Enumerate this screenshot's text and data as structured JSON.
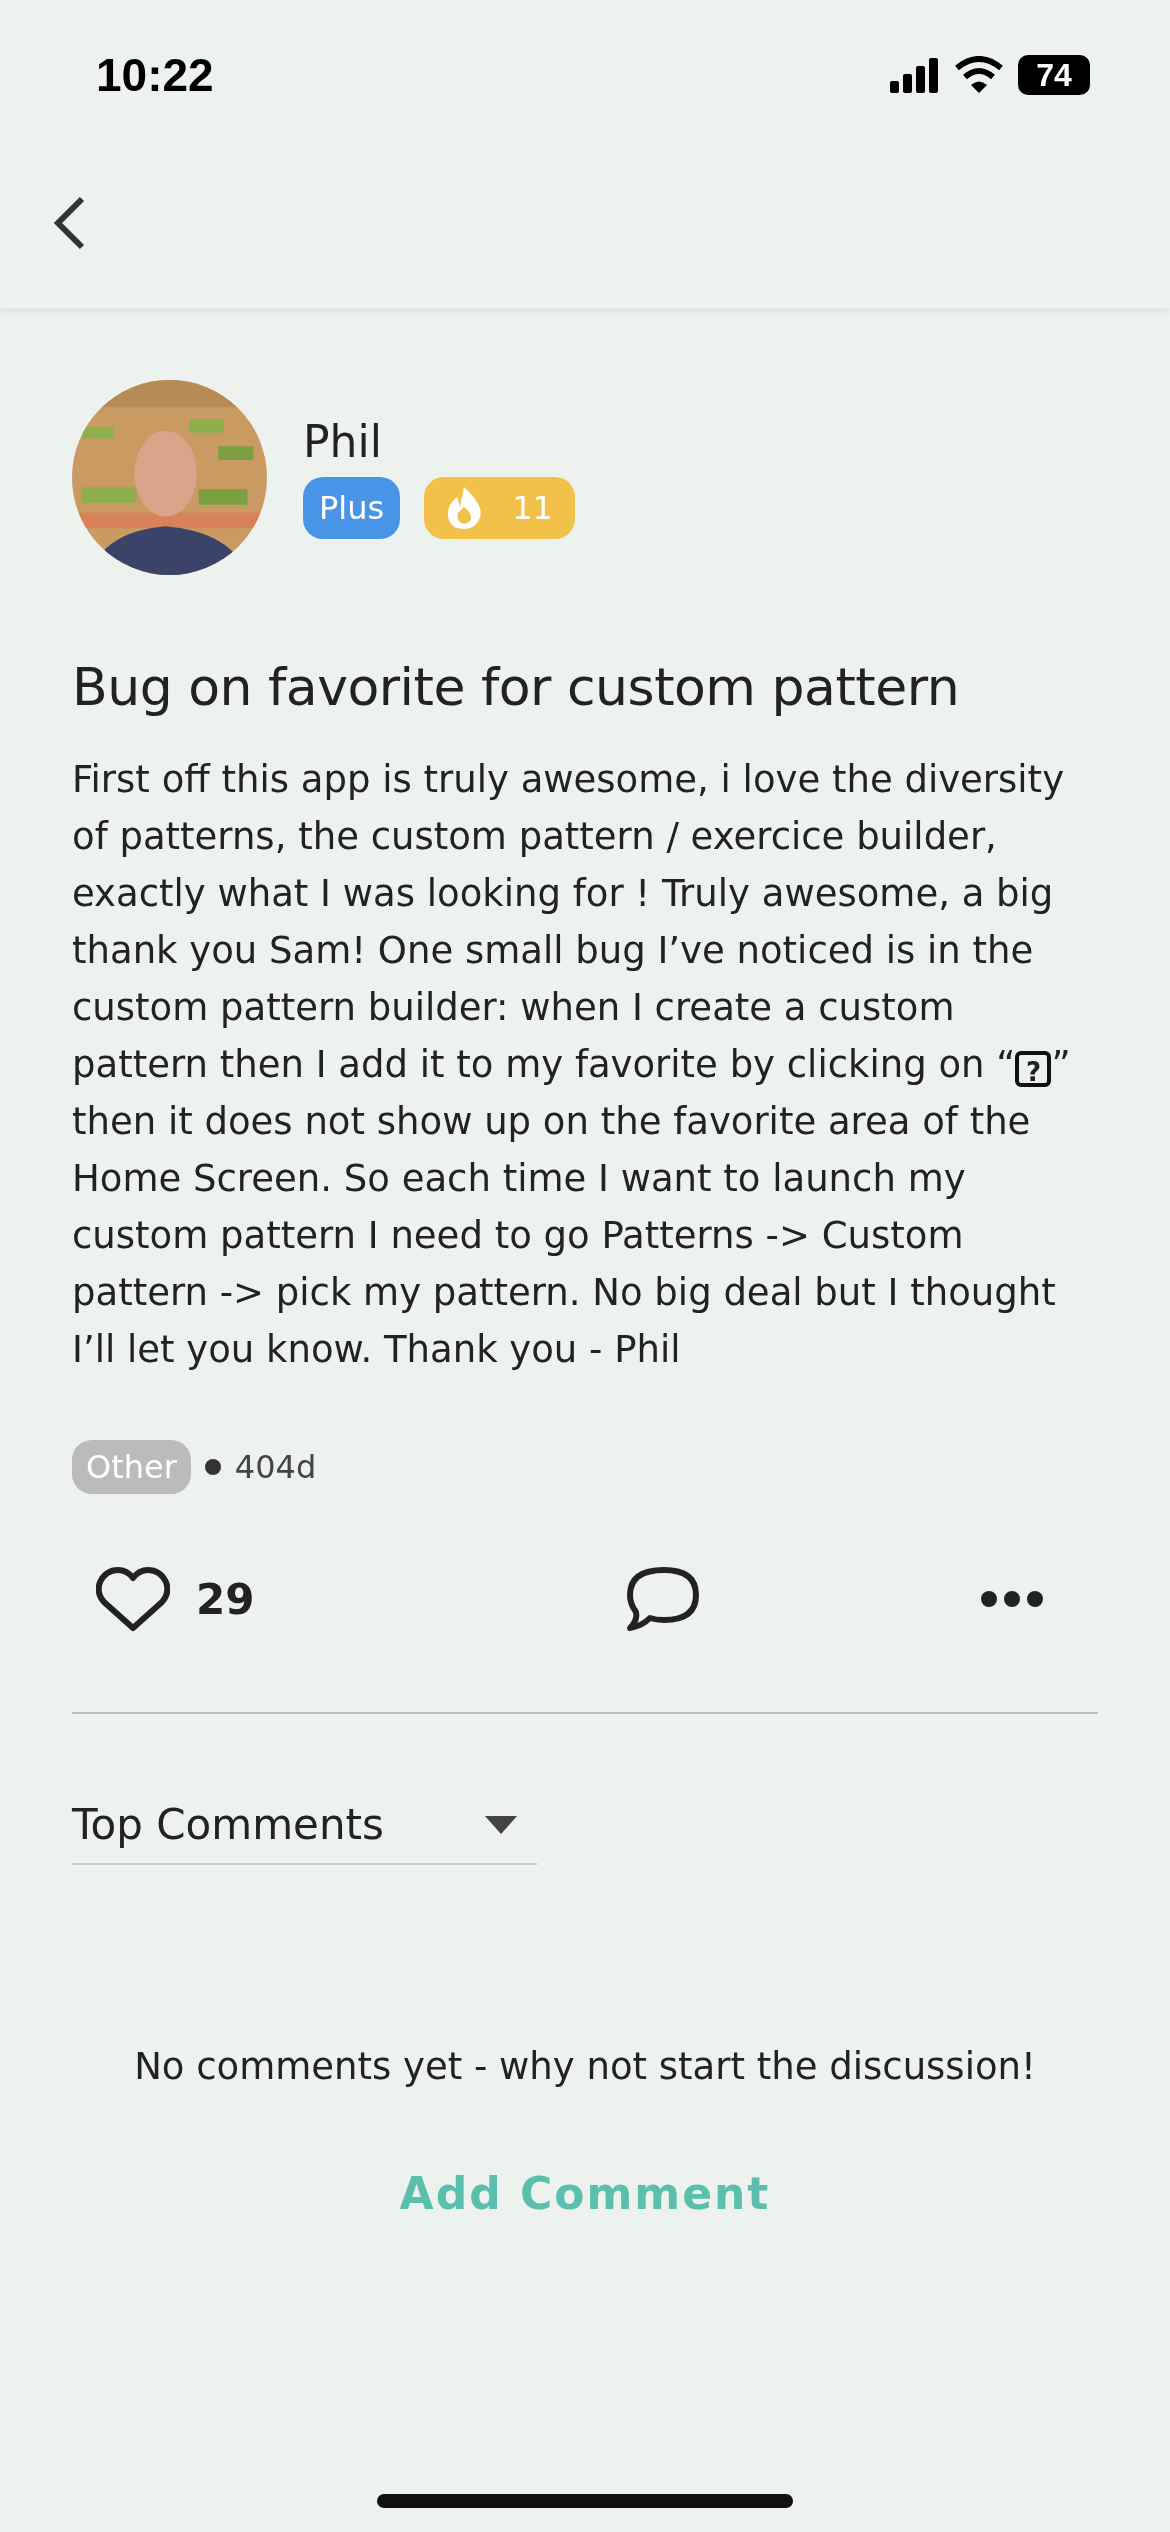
{
  "status_bar": {
    "time": "10:22",
    "battery": "74"
  },
  "author": {
    "name": "Phil",
    "badges": [
      {
        "kind": "plan",
        "label": "Plus",
        "color": "#4a94e8"
      },
      {
        "kind": "streak",
        "label": "11",
        "color": "#f2c14a"
      }
    ]
  },
  "post": {
    "title": "Bug on favorite for custom pattern",
    "body_before": "First off this app is truly awesome, i love the diversity of patterns, the custom pattern / exercice builder, exactly what I was looking for ! Truly awesome, a big thank you Sam! One small bug I’ve noticed is in the custom pattern builder: when I create a custom pattern then I add it to my favorite by clicking on “",
    "body_symbol": "?",
    "body_after": "” then it does not show up on the favorite area of the Home Screen. So each time I want to launch my custom pattern I need to go Patterns -> Custom pattern -> pick my pattern.  No big deal but I thought I’ll let you know. Thank you - Phil",
    "tag": "Other",
    "age": "404d",
    "likes": "29"
  },
  "comments": {
    "sort": "Top Comments",
    "empty_message": "No comments yet - why not start the discussion!",
    "add_button": "Add Comment"
  }
}
